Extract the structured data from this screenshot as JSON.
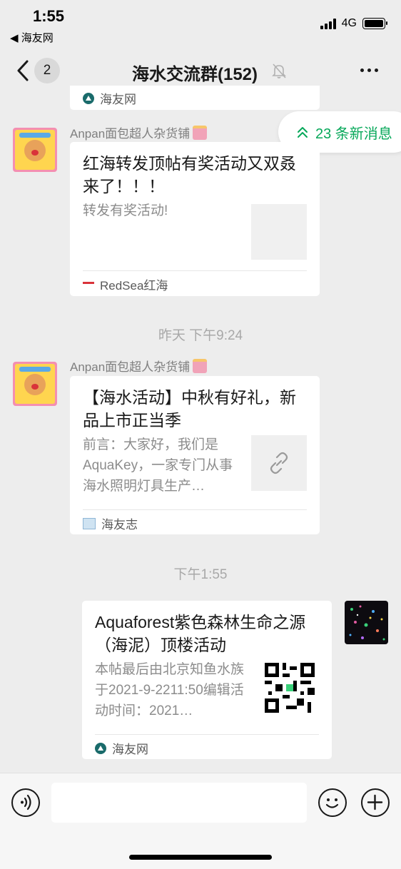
{
  "status_bar": {
    "time": "1:55",
    "back_app": "◀ 海友网",
    "network": "4G"
  },
  "nav": {
    "unread_count": "2",
    "title": "海水交流群(152)"
  },
  "new_messages": {
    "label": "23 条新消息"
  },
  "partial_card": {
    "source": "海友网"
  },
  "messages": [
    {
      "sender": "Anpan面包超人杂货铺",
      "title": "红海转发顶帖有奖活动又双叒来了！！！",
      "desc": "转发有奖活动!",
      "source": "RedSea红海"
    },
    {
      "timestamp": "昨天 下午9:24",
      "sender": "Anpan面包超人杂货铺",
      "title": "【海水活动】中秋有好礼，新品上市正当季",
      "desc": "前言：大家好，我们是AquaKey，一家专门从事海水照明灯具生产…",
      "source": "海友志"
    },
    {
      "timestamp": "下午1:55",
      "title": "Aquaforest紫色森林生命之源（海泥）顶楼活动",
      "desc": "本帖最后由北京知鱼水族于2021-9-2211:50编辑活动时间：2021…",
      "source": "海友网"
    }
  ],
  "colors": {
    "background": "#ededed",
    "accent_green": "#07a85a",
    "card": "#ffffff"
  },
  "icons": [
    "back-chevron-icon",
    "mute-bell-icon",
    "more-dots-icon",
    "double-chevron-up-icon",
    "link-icon",
    "voice-icon",
    "emoji-icon",
    "plus-icon",
    "shopping-bag-icon"
  ]
}
